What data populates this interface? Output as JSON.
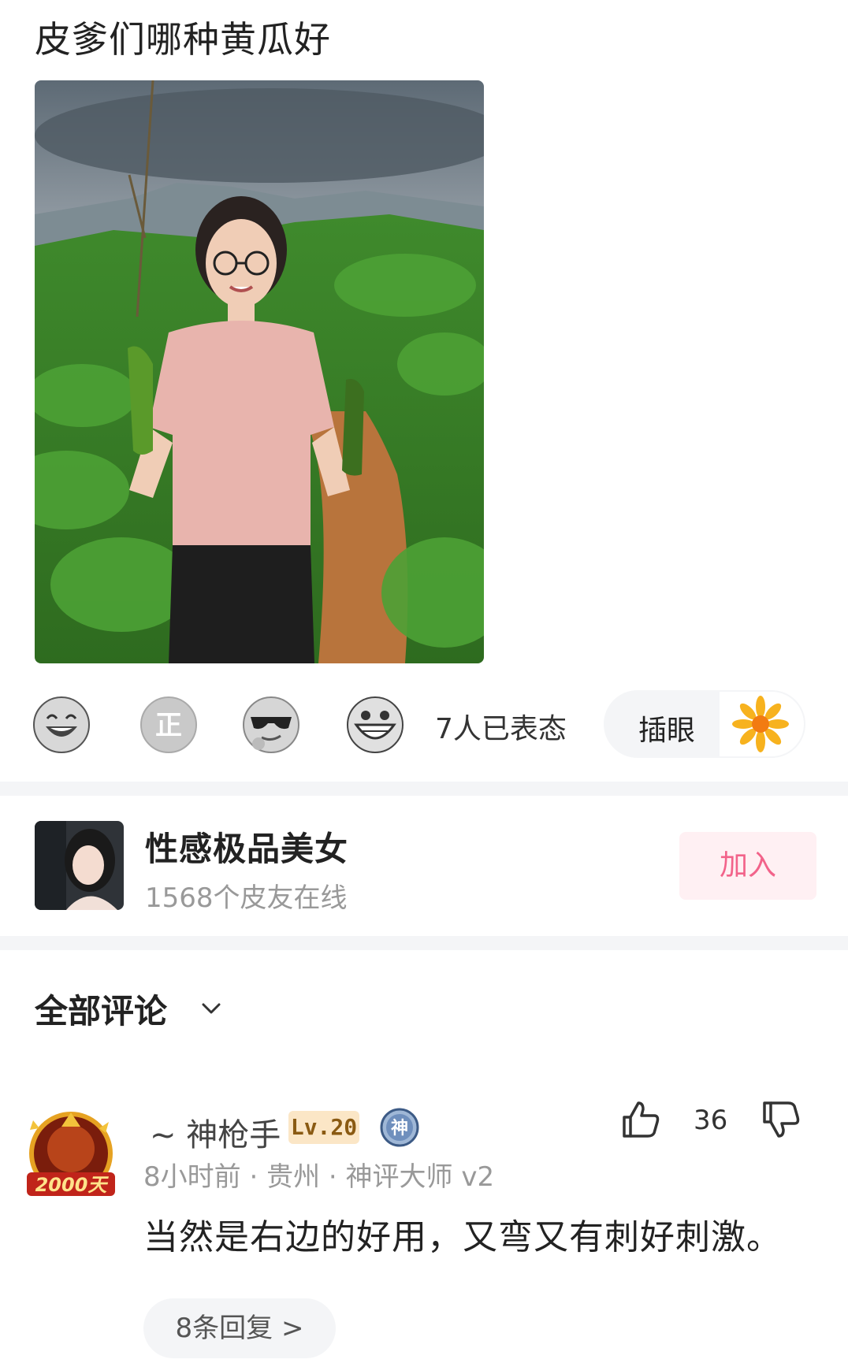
{
  "post": {
    "title": "皮爹们哪种黄瓜好"
  },
  "reactions": {
    "icons": [
      "laughing-face",
      "zheng-badge",
      "sunglasses-face",
      "grinning-face"
    ],
    "count_text": "7人已表态"
  },
  "peek": {
    "label": "插眼",
    "icon": "sunflower"
  },
  "group": {
    "name": "性感极品美女",
    "online": "1568个皮友在线",
    "join_label": "加入"
  },
  "comments": {
    "header": "全部评论",
    "items": [
      {
        "username": "~ 神枪手",
        "level": "Lv.20",
        "badge_char": "神",
        "avatar_badge_text": "2000天",
        "time": "8小时前",
        "location": "贵州",
        "title": "神评大师 v2",
        "text": "当然是右边的好用，又弯又有刺好刺激。",
        "likes": "36",
        "replies_label": "8条回复 >"
      }
    ]
  },
  "colors": {
    "accent_pink": "#f2638a",
    "join_bg": "#fff0f3",
    "divider": "#f4f5f7",
    "level_bg": "#fbe6c6"
  }
}
